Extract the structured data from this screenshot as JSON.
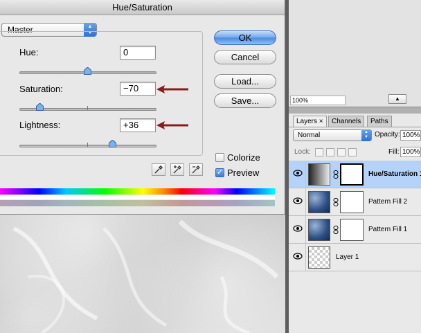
{
  "dialog": {
    "title": "Hue/Saturation",
    "edit_menu": {
      "selected": "Master"
    },
    "hue": {
      "label": "Hue:",
      "value": "0"
    },
    "saturation": {
      "label": "Saturation:",
      "value": "−70"
    },
    "lightness": {
      "label": "Lightness:",
      "value": "+36"
    },
    "buttons": {
      "ok": "OK",
      "cancel": "Cancel",
      "load": "Load...",
      "save": "Save..."
    },
    "colorize": {
      "label": "Colorize",
      "checked": false
    },
    "preview": {
      "label": "Preview",
      "checked": true
    },
    "eyedroppers": [
      "eyedropper-icon",
      "eyedropper-plus-icon",
      "eyedropper-minus-icon"
    ]
  },
  "navigator": {
    "zoom": "100%"
  },
  "layers_panel": {
    "tabs": [
      {
        "label": "Layers",
        "active": true,
        "close": "×"
      },
      {
        "label": "Channels"
      },
      {
        "label": "Paths"
      }
    ],
    "blend_mode": "Normal",
    "opacity": {
      "label": "Opacity:",
      "value": "100%"
    },
    "lock": {
      "label": "Lock:"
    },
    "fill": {
      "label": "Fill:",
      "value": "100%"
    },
    "layers": [
      {
        "name": "Hue/Saturation 1",
        "type": "adjustment",
        "selected": true,
        "visible": true
      },
      {
        "name": "Pattern Fill 2",
        "type": "pattern",
        "selected": false,
        "visible": true
      },
      {
        "name": "Pattern Fill 1",
        "type": "pattern",
        "selected": false,
        "visible": true
      },
      {
        "name": "Layer 1",
        "type": "pixel",
        "selected": false,
        "visible": true
      }
    ]
  },
  "colors": {
    "accent_blue": "#4a8ae0",
    "annotation_arrow": "#8b1a1a",
    "selected_row": "#b5d3f8"
  }
}
